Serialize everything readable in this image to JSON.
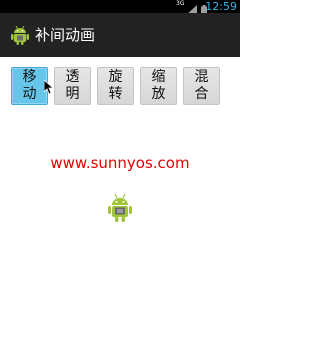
{
  "status_bar": {
    "network": "3G",
    "time": "12:59"
  },
  "action_bar": {
    "title": "补间动画",
    "icon": "android-robot-icon"
  },
  "buttons": [
    {
      "label": "移动",
      "pressed": true
    },
    {
      "label": "透明",
      "pressed": false
    },
    {
      "label": "旋转",
      "pressed": false
    },
    {
      "label": "缩放",
      "pressed": false
    },
    {
      "label": "混合",
      "pressed": false
    }
  ],
  "website_text": "www.sunnyos.com",
  "animated_image": "android-robot-icon",
  "colors": {
    "status_bar_bg": "#000000",
    "time_color": "#33b5e5",
    "action_bar_bg": "#222222",
    "pressed_button": "#65c6ea",
    "website_text": "#e60000",
    "android_green": "#9fc63b"
  }
}
